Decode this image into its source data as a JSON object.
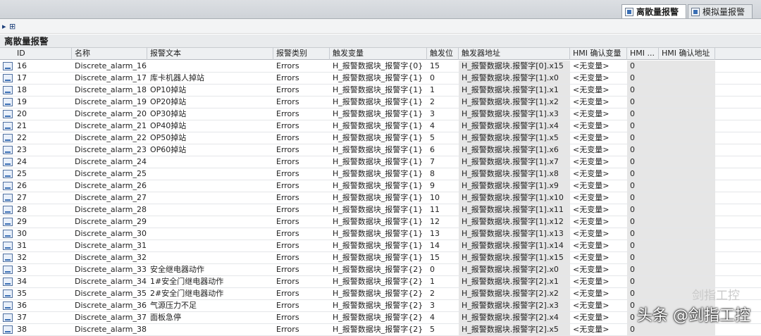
{
  "tabs": [
    {
      "label": "离散量报警",
      "active": true
    },
    {
      "label": "模拟量报警",
      "active": false
    }
  ],
  "toolbar": {
    "expand_label": "▸",
    "add_label": "⊞"
  },
  "section_title": "离散量报警",
  "columns": [
    "ID",
    "名称",
    "报警文本",
    "报警类别",
    "触发变量",
    "触发位",
    "触发器地址",
    "HMI 确认变量",
    "HMI ...",
    "HMI 确认地址"
  ],
  "rows": [
    {
      "id": "16",
      "name": "Discrete_alarm_16",
      "text": "",
      "cls": "Errors",
      "var": "H_报警数据块_报警字{0}",
      "bit": "15",
      "addr": "H_报警数据块.报警字[0].x15",
      "ack": "<无变量>",
      "hmi": "0"
    },
    {
      "id": "17",
      "name": "Discrete_alarm_17",
      "text": "库卡机器人掉站",
      "cls": "Errors",
      "var": "H_报警数据块_报警字{1}",
      "bit": "0",
      "addr": "H_报警数据块.报警字[1].x0",
      "ack": "<无变量>",
      "hmi": "0"
    },
    {
      "id": "18",
      "name": "Discrete_alarm_18",
      "text": "OP10掉站",
      "cls": "Errors",
      "var": "H_报警数据块_报警字{1}",
      "bit": "1",
      "addr": "H_报警数据块.报警字[1].x1",
      "ack": "<无变量>",
      "hmi": "0"
    },
    {
      "id": "19",
      "name": "Discrete_alarm_19",
      "text": "OP20掉站",
      "cls": "Errors",
      "var": "H_报警数据块_报警字{1}",
      "bit": "2",
      "addr": "H_报警数据块.报警字[1].x2",
      "ack": "<无变量>",
      "hmi": "0"
    },
    {
      "id": "20",
      "name": "Discrete_alarm_20",
      "text": "OP30掉站",
      "cls": "Errors",
      "var": "H_报警数据块_报警字{1}",
      "bit": "3",
      "addr": "H_报警数据块.报警字[1].x3",
      "ack": "<无变量>",
      "hmi": "0"
    },
    {
      "id": "21",
      "name": "Discrete_alarm_21",
      "text": "OP40掉站",
      "cls": "Errors",
      "var": "H_报警数据块_报警字{1}",
      "bit": "4",
      "addr": "H_报警数据块.报警字[1].x4",
      "ack": "<无变量>",
      "hmi": "0"
    },
    {
      "id": "22",
      "name": "Discrete_alarm_22",
      "text": "OP50掉站",
      "cls": "Errors",
      "var": "H_报警数据块_报警字{1}",
      "bit": "5",
      "addr": "H_报警数据块.报警字[1].x5",
      "ack": "<无变量>",
      "hmi": "0"
    },
    {
      "id": "23",
      "name": "Discrete_alarm_23",
      "text": "OP60掉站",
      "cls": "Errors",
      "var": "H_报警数据块_报警字{1}",
      "bit": "6",
      "addr": "H_报警数据块.报警字[1].x6",
      "ack": "<无变量>",
      "hmi": "0"
    },
    {
      "id": "24",
      "name": "Discrete_alarm_24",
      "text": "",
      "cls": "Errors",
      "var": "H_报警数据块_报警字{1}",
      "bit": "7",
      "addr": "H_报警数据块.报警字[1].x7",
      "ack": "<无变量>",
      "hmi": "0"
    },
    {
      "id": "25",
      "name": "Discrete_alarm_25",
      "text": "",
      "cls": "Errors",
      "var": "H_报警数据块_报警字{1}",
      "bit": "8",
      "addr": "H_报警数据块.报警字[1].x8",
      "ack": "<无变量>",
      "hmi": "0"
    },
    {
      "id": "26",
      "name": "Discrete_alarm_26",
      "text": "",
      "cls": "Errors",
      "var": "H_报警数据块_报警字{1}",
      "bit": "9",
      "addr": "H_报警数据块.报警字[1].x9",
      "ack": "<无变量>",
      "hmi": "0"
    },
    {
      "id": "27",
      "name": "Discrete_alarm_27",
      "text": "",
      "cls": "Errors",
      "var": "H_报警数据块_报警字{1}",
      "bit": "10",
      "addr": "H_报警数据块.报警字[1].x10",
      "ack": "<无变量>",
      "hmi": "0"
    },
    {
      "id": "28",
      "name": "Discrete_alarm_28",
      "text": "",
      "cls": "Errors",
      "var": "H_报警数据块_报警字{1}",
      "bit": "11",
      "addr": "H_报警数据块.报警字[1].x11",
      "ack": "<无变量>",
      "hmi": "0"
    },
    {
      "id": "29",
      "name": "Discrete_alarm_29",
      "text": "",
      "cls": "Errors",
      "var": "H_报警数据块_报警字{1}",
      "bit": "12",
      "addr": "H_报警数据块.报警字[1].x12",
      "ack": "<无变量>",
      "hmi": "0"
    },
    {
      "id": "30",
      "name": "Discrete_alarm_30",
      "text": "",
      "cls": "Errors",
      "var": "H_报警数据块_报警字{1}",
      "bit": "13",
      "addr": "H_报警数据块.报警字[1].x13",
      "ack": "<无变量>",
      "hmi": "0"
    },
    {
      "id": "31",
      "name": "Discrete_alarm_31",
      "text": "",
      "cls": "Errors",
      "var": "H_报警数据块_报警字{1}",
      "bit": "14",
      "addr": "H_报警数据块.报警字[1].x14",
      "ack": "<无变量>",
      "hmi": "0"
    },
    {
      "id": "32",
      "name": "Discrete_alarm_32",
      "text": "",
      "cls": "Errors",
      "var": "H_报警数据块_报警字{1}",
      "bit": "15",
      "addr": "H_报警数据块.报警字[1].x15",
      "ack": "<无变量>",
      "hmi": "0"
    },
    {
      "id": "33",
      "name": "Discrete_alarm_33",
      "text": "安全继电器动作",
      "cls": "Errors",
      "var": "H_报警数据块_报警字{2}",
      "bit": "0",
      "addr": "H_报警数据块.报警字[2].x0",
      "ack": "<无变量>",
      "hmi": "0"
    },
    {
      "id": "34",
      "name": "Discrete_alarm_34",
      "text": "1#安全门继电器动作",
      "cls": "Errors",
      "var": "H_报警数据块_报警字{2}",
      "bit": "1",
      "addr": "H_报警数据块.报警字[2].x1",
      "ack": "<无变量>",
      "hmi": "0"
    },
    {
      "id": "35",
      "name": "Discrete_alarm_35",
      "text": "2#安全门继电器动作",
      "cls": "Errors",
      "var": "H_报警数据块_报警字{2}",
      "bit": "2",
      "addr": "H_报警数据块.报警字[2].x2",
      "ack": "<无变量>",
      "hmi": "0"
    },
    {
      "id": "36",
      "name": "Discrete_alarm_36",
      "text": "气源压力不足",
      "cls": "Errors",
      "var": "H_报警数据块_报警字{2}",
      "bit": "3",
      "addr": "H_报警数据块.报警字[2].x3",
      "ack": "<无变量>",
      "hmi": "0"
    },
    {
      "id": "37",
      "name": "Discrete_alarm_37",
      "text": "面板急停",
      "cls": "Errors",
      "var": "H_报警数据块_报警字{2}",
      "bit": "4",
      "addr": "H_报警数据块.报警字[2].x4",
      "ack": "<无变量>",
      "hmi": "0"
    },
    {
      "id": "38",
      "name": "Discrete_alarm_38",
      "text": "",
      "cls": "Errors",
      "var": "H_报警数据块_报警字{2}",
      "bit": "5",
      "addr": "H_报警数据块.报警字[2].x5",
      "ack": "<无变量>",
      "hmi": "0"
    }
  ],
  "watermark": {
    "top": "剑指工控",
    "bottom": "头条 @剑指工控"
  }
}
